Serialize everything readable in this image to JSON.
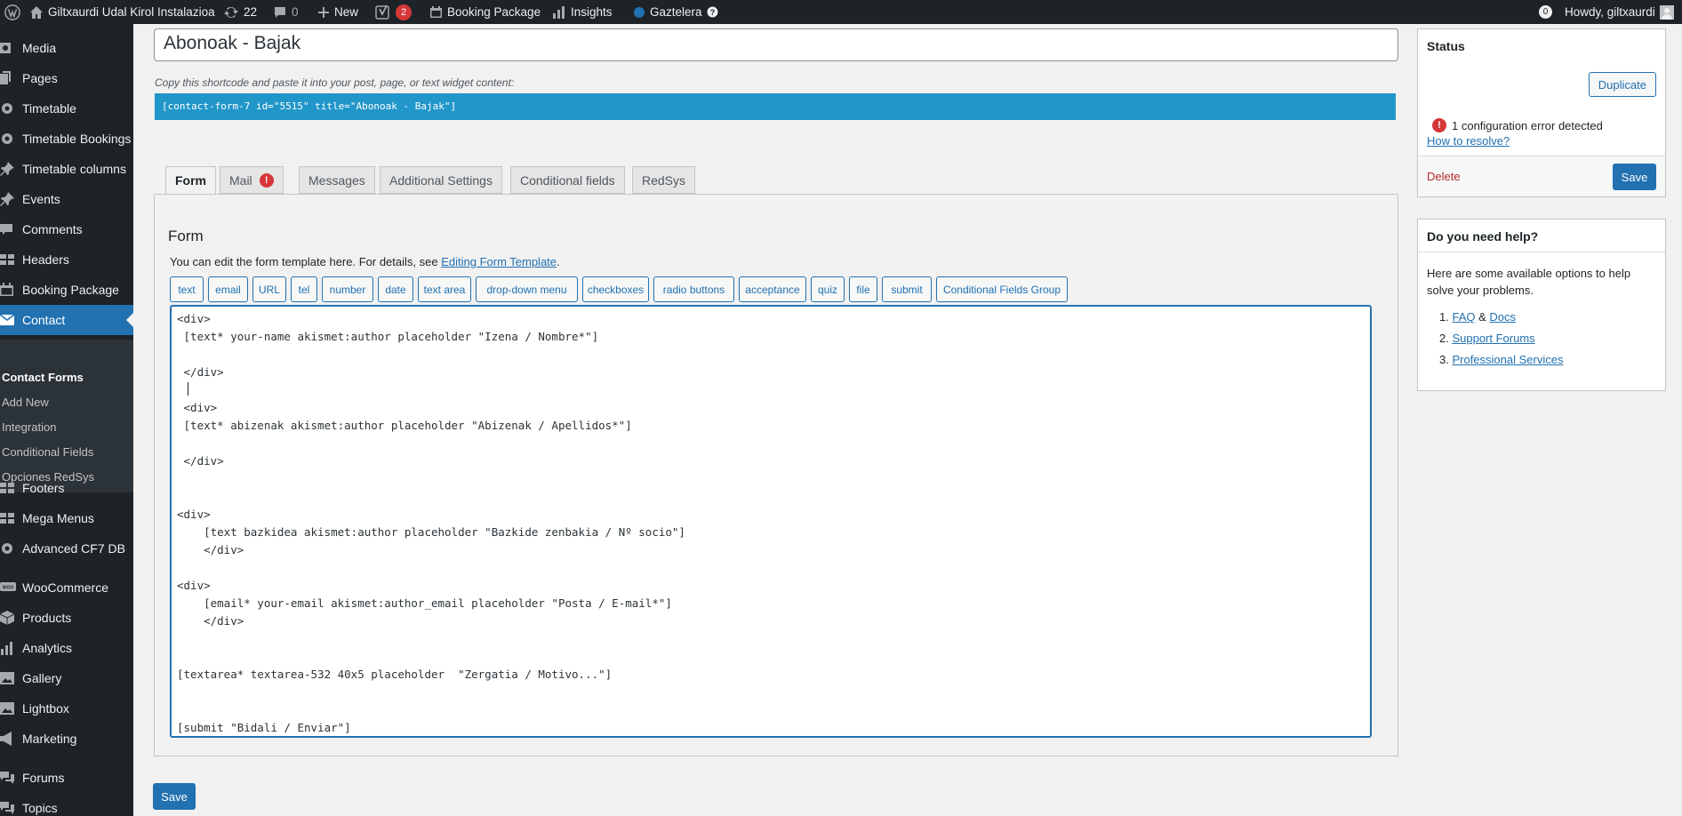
{
  "adminbar": {
    "site_name": "Giltxaurdi Udal Kirol Instalazioa",
    "updates_count": "22",
    "comments_count": "0",
    "new_label": "New",
    "yoast_count": "2",
    "booking_label": "Booking Package",
    "insights_label": "Insights",
    "language_label": "Gaztelera",
    "notif_count": "0",
    "howdy": "Howdy, giltxaurdi"
  },
  "sidebar": {
    "items": [
      {
        "label": "Media",
        "icon": "media-icon"
      },
      {
        "label": "Pages",
        "icon": "pages-icon"
      },
      {
        "label": "Timetable",
        "icon": "gear-icon"
      },
      {
        "label": "Timetable Bookings",
        "icon": "gear-icon"
      },
      {
        "label": "Timetable columns",
        "icon": "pin-icon"
      },
      {
        "label": "Events",
        "icon": "pin-icon"
      },
      {
        "label": "Comments",
        "icon": "comment-icon"
      },
      {
        "label": "Headers",
        "icon": "grid-icon"
      },
      {
        "label": "Booking Package",
        "icon": "calendar-icon"
      },
      {
        "label": "Contact",
        "icon": "mail-icon"
      },
      {
        "label": "Footers",
        "icon": "grid-icon"
      },
      {
        "label": "Mega Menus",
        "icon": "grid-icon"
      },
      {
        "label": "Advanced CF7 DB",
        "icon": "gear-icon"
      },
      {
        "label": "WooCommerce",
        "icon": "woo-icon"
      },
      {
        "label": "Products",
        "icon": "box-icon"
      },
      {
        "label": "Analytics",
        "icon": "chart-icon"
      },
      {
        "label": "Gallery",
        "icon": "image-icon"
      },
      {
        "label": "Lightbox",
        "icon": "image-icon"
      },
      {
        "label": "Marketing",
        "icon": "megaphone-icon"
      },
      {
        "label": "Forums",
        "icon": "forums-icon"
      },
      {
        "label": "Topics",
        "icon": "topics-icon"
      }
    ],
    "submenu": [
      "Contact Forms",
      "Add New",
      "Integration",
      "Conditional Fields",
      "Opciones RedSys"
    ]
  },
  "form": {
    "title_value": "Abonoak - Bajak",
    "shortcode_label": "Copy this shortcode and paste it into your post, page, or text widget content:",
    "shortcode": "[contact-form-7 id=\"5515\" title=\"Abonoak - Bajak\"]",
    "tabs": [
      "Form",
      "Mail",
      "Messages",
      "Additional Settings",
      "Conditional fields",
      "RedSys"
    ],
    "mail_warning": "!",
    "panel_title": "Form",
    "desc_prefix": "You can edit the form template here. For details, see ",
    "desc_link": "Editing Form Template",
    "desc_suffix": ".",
    "tag_buttons": [
      "text",
      "email",
      "URL",
      "tel",
      "number",
      "date",
      "text area",
      "drop-down menu",
      "checkboxes",
      "radio buttons",
      "acceptance",
      "quiz",
      "file",
      "submit",
      "Conditional Fields Group"
    ],
    "code_lines": [
      "<div>",
      " [text* your-name akismet:author placeholder \"Izena / Nombre*\"]",
      "",
      " </div>",
      "",
      " <div>",
      " [text* abizenak akismet:author placeholder \"Abizenak / Apellidos*\"]",
      "",
      " </div>",
      "",
      "",
      "<div>",
      "    [text bazkidea akismet:author placeholder \"Bazkide zenbakia / Nº socio\"]",
      "    </div>",
      "",
      "<div>",
      "    [email* your-email akismet:author_email placeholder \"Posta / E-mail*\"]",
      "    </div>",
      "",
      "",
      "[textarea* textarea-532 40x5 placeholder  \"Zergatia / Motivo...\"]",
      "",
      "",
      "[submit \"Bidali / Enviar\"]"
    ],
    "save_label": "Save"
  },
  "status_box": {
    "title": "Status",
    "duplicate_label": "Duplicate",
    "error_text": "1 configuration error detected",
    "resolve_link": "How to resolve?",
    "delete_label": "Delete",
    "save_label": "Save"
  },
  "help_box": {
    "title": "Do you need help?",
    "text": "Here are some available options to help solve your problems.",
    "item1_a": "FAQ",
    "item1_sep": " & ",
    "item1_b": "Docs",
    "item2": "Support Forums",
    "item3": "Professional Services"
  },
  "colors": {
    "accent": "#2271b1",
    "adminbar": "#1d2327",
    "shortcode_bg": "#2196c9",
    "error": "#d63638"
  }
}
